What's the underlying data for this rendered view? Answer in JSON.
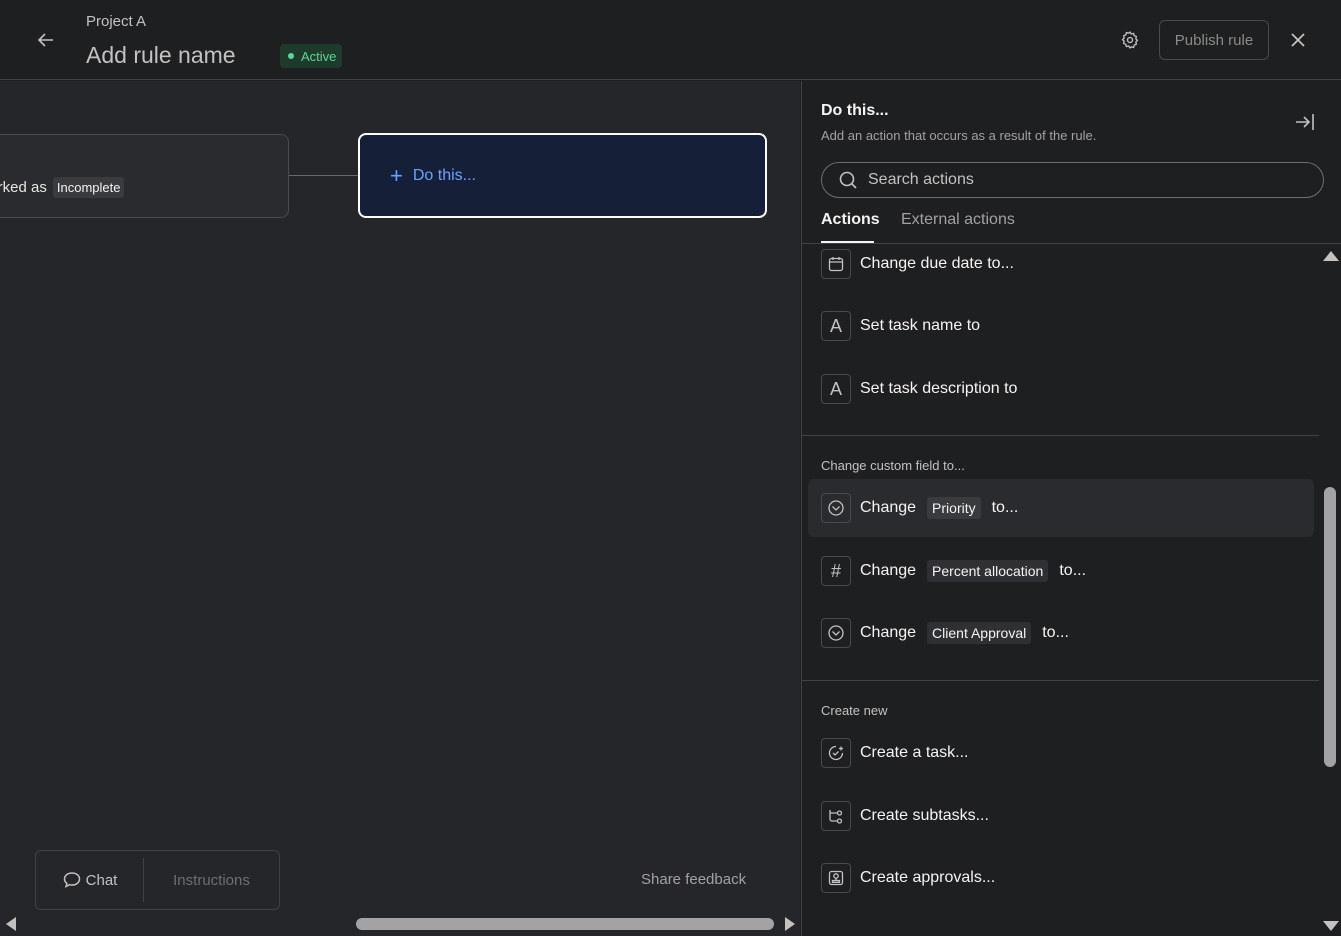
{
  "header": {
    "project_name": "Project A",
    "rule_name": "Add rule name",
    "status": "Active",
    "publish_label": "Publish rule",
    "icons": {
      "back": "arrow-left-icon",
      "settings": "gear-icon",
      "close": "close-icon"
    }
  },
  "canvas": {
    "trigger": {
      "prefix": "narked as",
      "value": "Incomplete"
    },
    "action_placeholder": "Do this...",
    "chat_label": "Chat",
    "instructions_label": "Instructions",
    "share_feedback": "Share feedback"
  },
  "panel": {
    "title": "Do this...",
    "subtitle": "Add an action that occurs as a result of the rule.",
    "search_placeholder": "Search actions",
    "tabs": [
      {
        "label": "Actions",
        "active": true
      },
      {
        "label": "External actions",
        "active": false
      }
    ],
    "items": {
      "due_date": "Change due date to...",
      "task_name": "Set task name to",
      "task_description": "Set task description to"
    },
    "custom_field_section": {
      "label": "Change custom field to...",
      "change_word": "Change",
      "to_word": "to...",
      "fields": [
        "Priority",
        "Percent allocation",
        "Client Approval"
      ]
    },
    "create_section": {
      "label": "Create new",
      "items": [
        "Create a task...",
        "Create subtasks...",
        "Create approvals..."
      ]
    }
  },
  "colors": {
    "background": "#1e1f21",
    "canvas": "#25262a",
    "accent_blue": "#6aa3ff",
    "active_green": "#5dd49a",
    "do_card_bg": "#152038"
  }
}
